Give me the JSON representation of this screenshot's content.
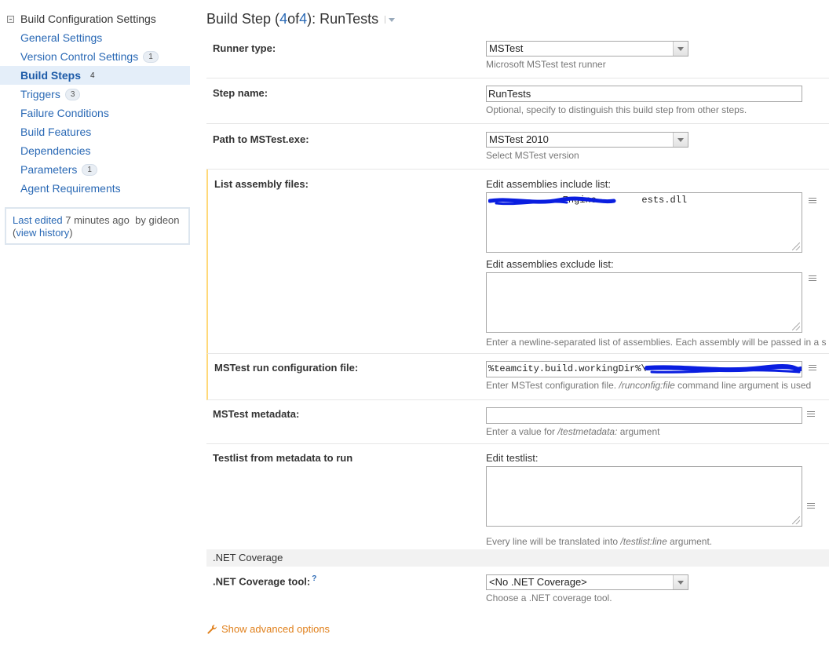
{
  "sidebar": {
    "title": "Build Configuration Settings",
    "items": [
      {
        "label": "General Settings",
        "badge": ""
      },
      {
        "label": "Version Control Settings",
        "badge": "1"
      },
      {
        "label": "Build Steps",
        "badge": "4",
        "active": true
      },
      {
        "label": "Triggers",
        "badge": "3"
      },
      {
        "label": "Failure Conditions",
        "badge": ""
      },
      {
        "label": "Build Features",
        "badge": ""
      },
      {
        "label": "Dependencies",
        "badge": ""
      },
      {
        "label": "Parameters",
        "badge": "1"
      },
      {
        "label": "Agent Requirements",
        "badge": ""
      }
    ],
    "last_edited": {
      "prefix": "Last edited",
      "time": "7 minutes ago",
      "by": "by gideon",
      "history_link": "view history"
    }
  },
  "header": {
    "prefix": "Build Step (",
    "current": "4",
    "of": " of ",
    "total": "4",
    "suffix": "): RunTests"
  },
  "form": {
    "runner_type": {
      "label": "Runner type:",
      "value": "MSTest",
      "hint": "Microsoft MSTest test runner"
    },
    "step_name": {
      "label": "Step name:",
      "value": "RunTests",
      "hint": "Optional, specify to distinguish this build step from other steps."
    },
    "mstest_path": {
      "label": "Path to MSTest.exe:",
      "value": "MSTest 2010",
      "hint": "Select MSTest version"
    },
    "assemblies": {
      "label": "List assembly files:",
      "include_label": "Edit assemblies include list:",
      "include_value": "            .Engine.       ests.dll",
      "exclude_label": "Edit assemblies exclude list:",
      "exclude_value": "",
      "hint": "Enter a newline-separated list of assemblies. Each assembly will be passed in a s"
    },
    "run_config": {
      "label": "MSTest run configuration file:",
      "value": "%teamcity.build.workingDir%\\",
      "hint_prefix": "Enter MSTest configuration file. ",
      "hint_italic": "/runconfig:file",
      "hint_suffix": " command line argument is used"
    },
    "metadata": {
      "label": "MSTest metadata:",
      "value": "",
      "hint_prefix": "Enter a value for ",
      "hint_italic": "/testmetadata:",
      "hint_suffix": " argument"
    },
    "testlist": {
      "label": "Testlist from metadata to run",
      "sub_label": "Edit testlist:",
      "value": "",
      "hint_prefix": "Every line will be translated into ",
      "hint_italic": "/testlist:line",
      "hint_suffix": " argument."
    },
    "coverage_section": ".NET Coverage",
    "coverage_tool": {
      "label": ".NET Coverage tool:",
      "help": "?",
      "value": "<No .NET Coverage>",
      "hint": "Choose a .NET coverage tool."
    }
  },
  "advanced_link": "Show advanced options",
  "colors": {
    "link": "#2a69b5",
    "accent": "#e0801c",
    "group_bar": "#ffd97a",
    "scribble": "#0a1ee0"
  }
}
